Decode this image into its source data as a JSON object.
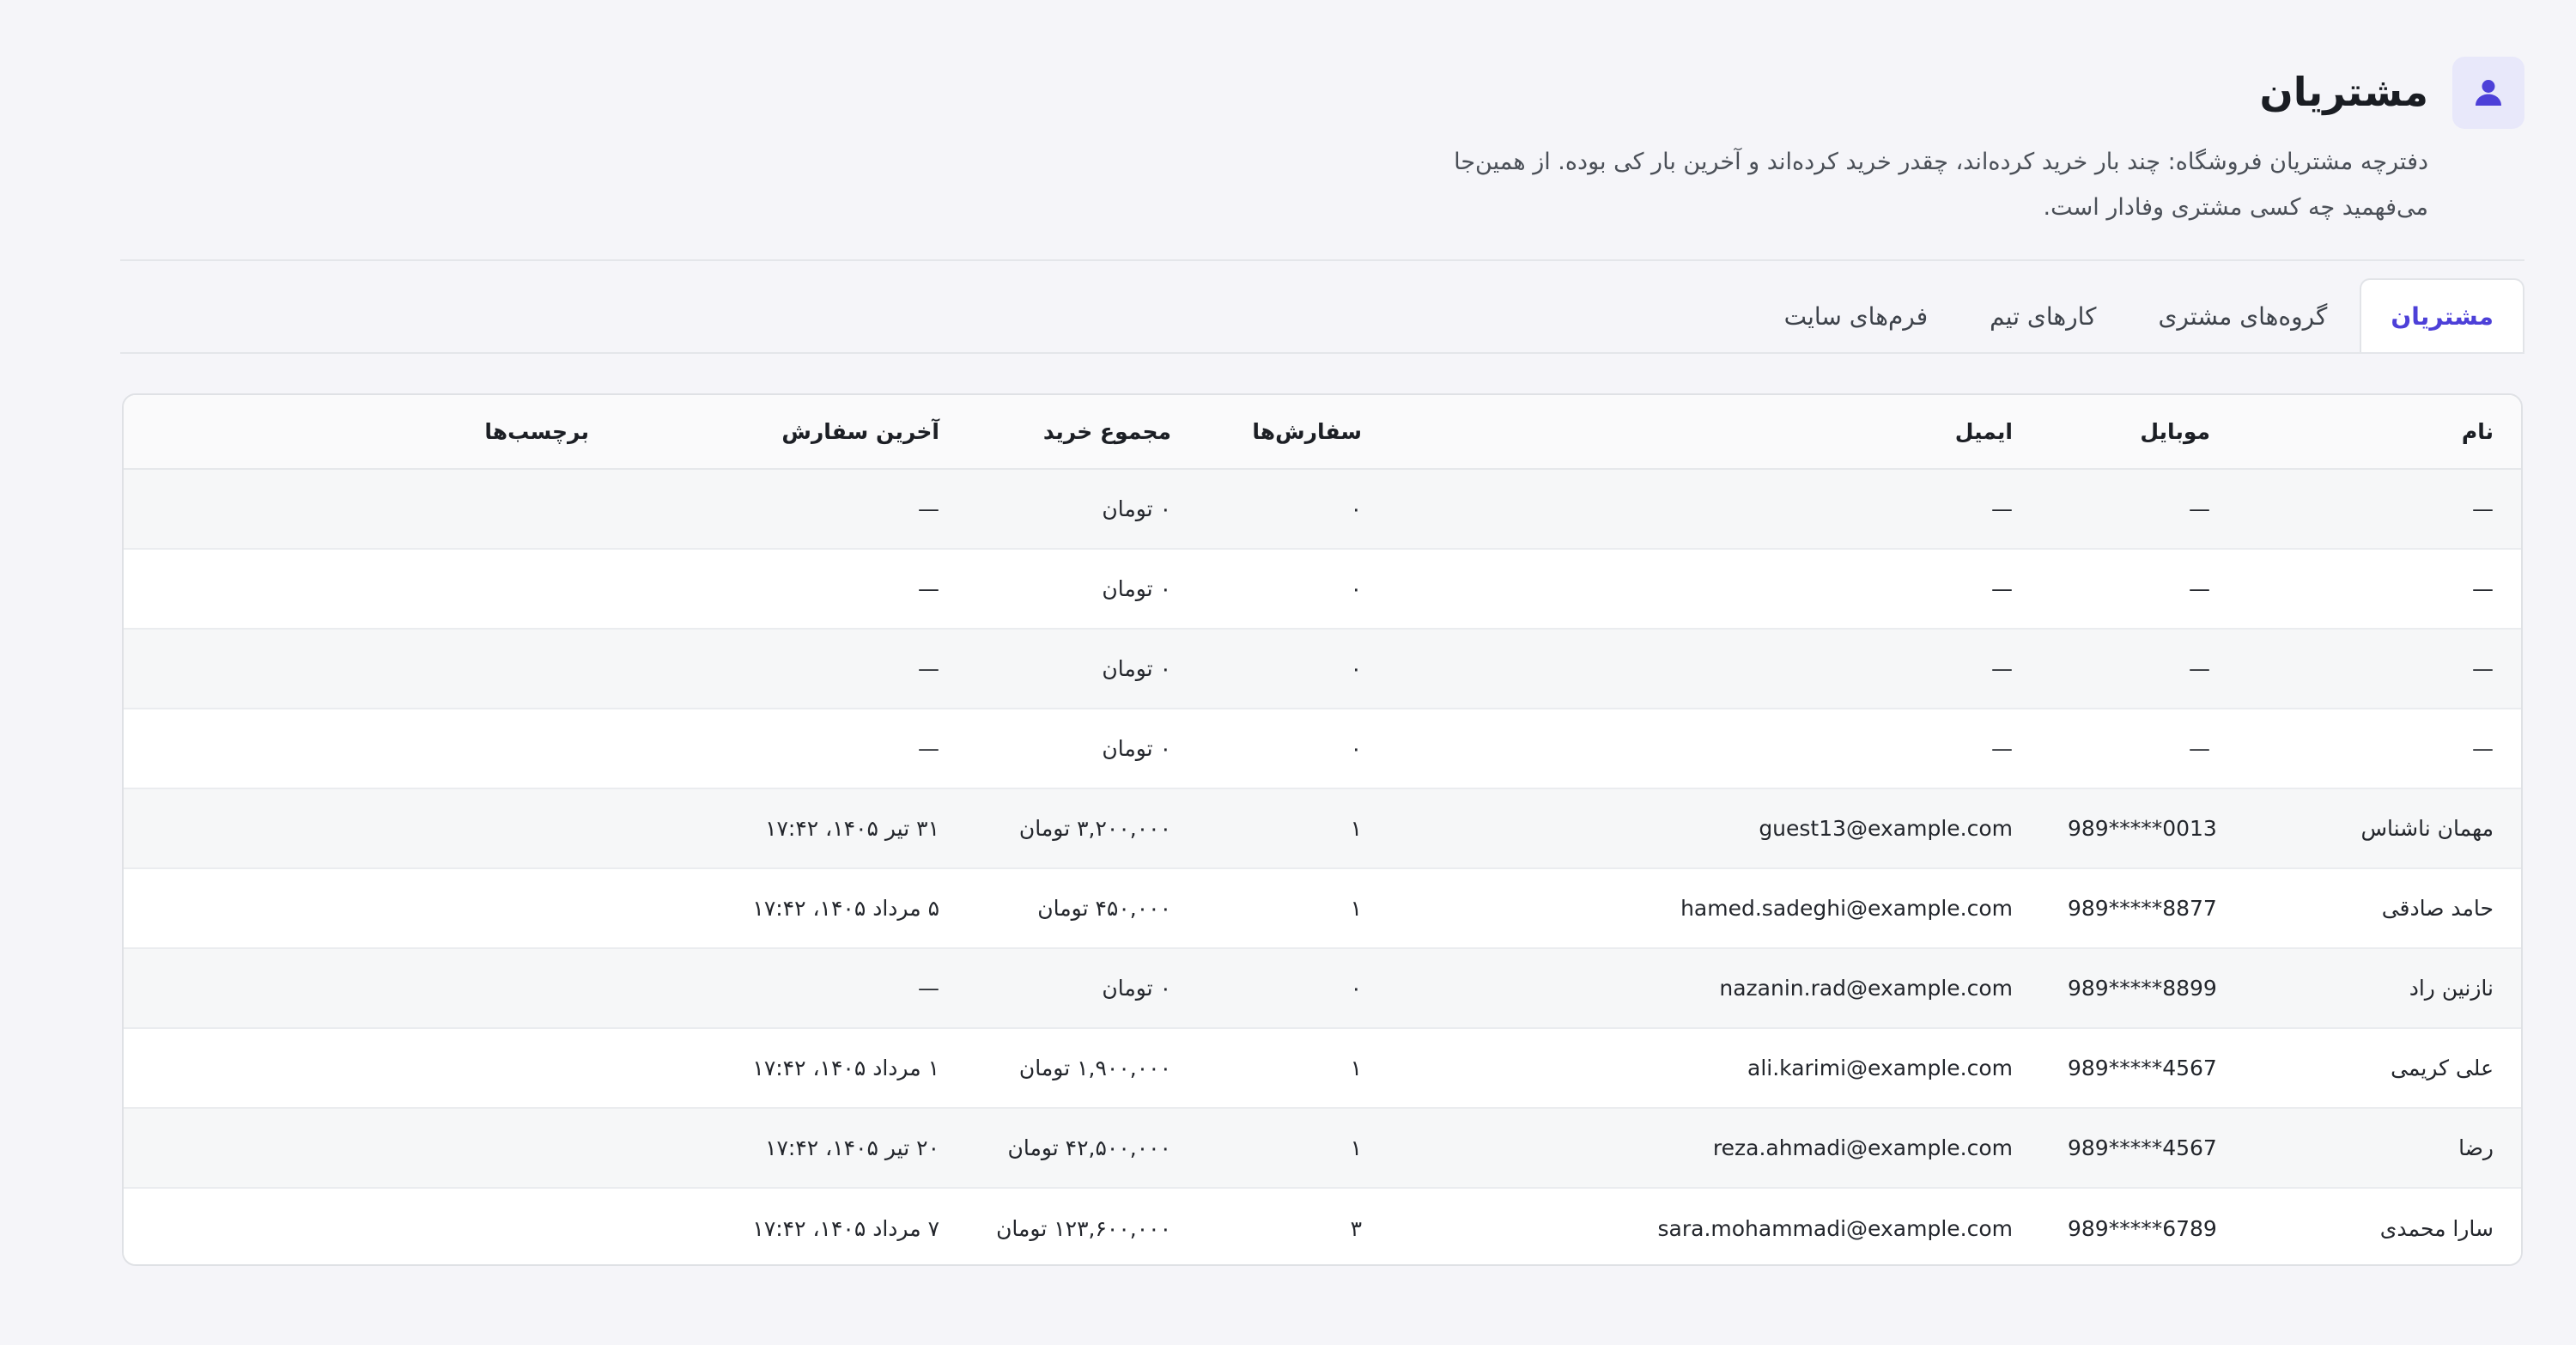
{
  "header": {
    "title": "مشتریان",
    "description": "دفترچه مشتریان فروشگاه: چند بار خرید کرده‌اند، چقدر خرید کرده‌اند و آخرین بار کی بوده. از همین‌جا می‌فهمید چه کسی مشتری وفادار است.",
    "icon": "user-icon",
    "accent_color": "#4d40d8"
  },
  "tabs": [
    {
      "label": "مشتریان",
      "active": true
    },
    {
      "label": "گروه‌های مشتری",
      "active": false
    },
    {
      "label": "کارهای تیم",
      "active": false
    },
    {
      "label": "فرم‌های سایت",
      "active": false
    }
  ],
  "table": {
    "columns": {
      "name": "نام",
      "mobile": "موبایل",
      "email": "ایمیل",
      "orders": "سفارش‌ها",
      "total": "مجموع خرید",
      "last_order": "آخرین سفارش",
      "tags": "برچسب‌ها"
    },
    "rows": [
      {
        "name": "—",
        "mobile": "—",
        "email": "—",
        "orders": "۰",
        "total": "۰ تومان",
        "last_order": "—",
        "tags": ""
      },
      {
        "name": "—",
        "mobile": "—",
        "email": "—",
        "orders": "۰",
        "total": "۰ تومان",
        "last_order": "—",
        "tags": ""
      },
      {
        "name": "—",
        "mobile": "—",
        "email": "—",
        "orders": "۰",
        "total": "۰ تومان",
        "last_order": "—",
        "tags": ""
      },
      {
        "name": "—",
        "mobile": "—",
        "email": "—",
        "orders": "۰",
        "total": "۰ تومان",
        "last_order": "—",
        "tags": ""
      },
      {
        "name": "مهمان ناشناس",
        "mobile": "989*****0013",
        "email": "guest13@example.com",
        "orders": "۱",
        "total": "۳,۲۰۰,۰۰۰ تومان",
        "last_order": "۳۱ تیر ۱۴۰۵، ۱۷:۴۲",
        "tags": ""
      },
      {
        "name": "حامد صادقی",
        "mobile": "989*****8877",
        "email": "hamed.sadeghi@example.com",
        "orders": "۱",
        "total": "۴۵۰,۰۰۰ تومان",
        "last_order": "۵ مرداد ۱۴۰۵، ۱۷:۴۲",
        "tags": ""
      },
      {
        "name": "نازنین راد",
        "mobile": "989*****8899",
        "email": "nazanin.rad@example.com",
        "orders": "۰",
        "total": "۰ تومان",
        "last_order": "—",
        "tags": ""
      },
      {
        "name": "علی کریمی",
        "mobile": "989*****4567",
        "email": "ali.karimi@example.com",
        "orders": "۱",
        "total": "۱,۹۰۰,۰۰۰ تومان",
        "last_order": "۱ مرداد ۱۴۰۵، ۱۷:۴۲",
        "tags": ""
      },
      {
        "name": "رضا",
        "mobile": "989*****4567",
        "email": "reza.ahmadi@example.com",
        "orders": "۱",
        "total": "۴۲,۵۰۰,۰۰۰ تومان",
        "last_order": "۲۰ تیر ۱۴۰۵، ۱۷:۴۲",
        "tags": ""
      },
      {
        "name": "سارا محمدی",
        "mobile": "989*****6789",
        "email": "sara.mohammadi@example.com",
        "orders": "۳",
        "total": "۱۲۳,۶۰۰,۰۰۰ تومان",
        "last_order": "۷ مرداد ۱۴۰۵، ۱۷:۴۲",
        "tags": ""
      }
    ]
  }
}
